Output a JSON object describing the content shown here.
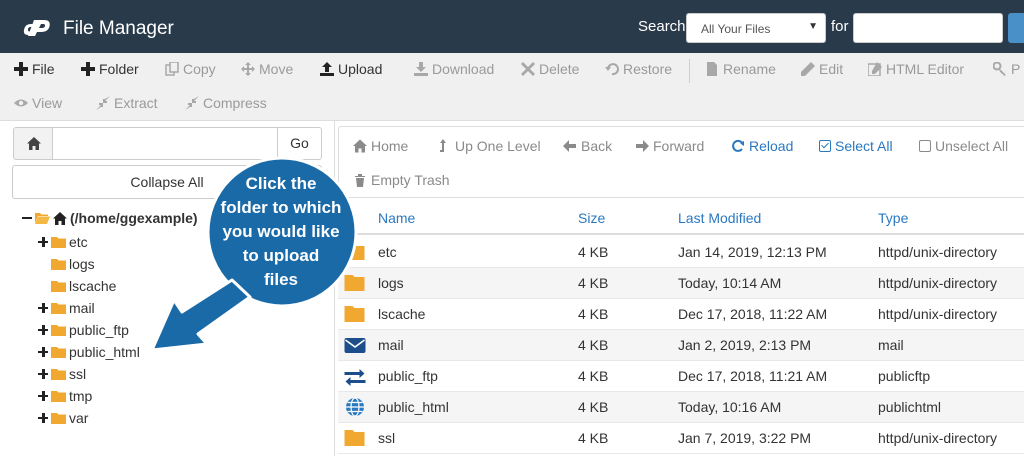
{
  "header": {
    "title": "File Manager",
    "search_label": "Search",
    "search_scope": "All Your Files",
    "for_label": "for",
    "search_value": ""
  },
  "toolbar": {
    "row1": [
      {
        "label": "File",
        "icon": "plus-icon",
        "enabled": true
      },
      {
        "label": "Folder",
        "icon": "plus-icon",
        "enabled": true
      },
      {
        "label": "Copy",
        "icon": "copy-icon",
        "enabled": false
      },
      {
        "label": "Move",
        "icon": "move-icon",
        "enabled": false
      },
      {
        "label": "Upload",
        "icon": "upload-icon",
        "enabled": true
      },
      {
        "label": "Download",
        "icon": "download-icon",
        "enabled": false
      },
      {
        "label": "Delete",
        "icon": "delete-icon",
        "enabled": false
      },
      {
        "label": "Restore",
        "icon": "restore-icon",
        "enabled": false
      },
      {
        "label": "Rename",
        "icon": "rename-icon",
        "enabled": false
      },
      {
        "label": "Edit",
        "icon": "pencil-icon",
        "enabled": false
      },
      {
        "label": "HTML Editor",
        "icon": "html-editor-icon",
        "enabled": false
      },
      {
        "label": "P",
        "icon": "key-icon",
        "enabled": false
      }
    ],
    "row2": [
      {
        "label": "View",
        "icon": "eye-icon",
        "enabled": false
      },
      {
        "label": "Extract",
        "icon": "extract-icon",
        "enabled": false
      },
      {
        "label": "Compress",
        "icon": "compress-icon",
        "enabled": false
      }
    ]
  },
  "left_panel": {
    "path_value": "",
    "go_label": "Go",
    "collapse_label": "Collapse All",
    "tree": {
      "root_label": "(/home/ggexample)",
      "children": [
        {
          "label": "etc",
          "expandable": true
        },
        {
          "label": "logs",
          "expandable": false
        },
        {
          "label": "lscache",
          "expandable": false
        },
        {
          "label": "mail",
          "expandable": true
        },
        {
          "label": "public_ftp",
          "expandable": true
        },
        {
          "label": "public_html",
          "expandable": true
        },
        {
          "label": "ssl",
          "expandable": true
        },
        {
          "label": "tmp",
          "expandable": true
        },
        {
          "label": "var",
          "expandable": true
        }
      ]
    }
  },
  "callout": {
    "lines": [
      "Click the",
      "folder to which",
      "you would like",
      "to upload",
      "files"
    ],
    "color": "#1a6aa8"
  },
  "nav": {
    "home": "Home",
    "up": "Up One Level",
    "back": "Back",
    "forward": "Forward",
    "reload": "Reload",
    "select_all": "Select All",
    "unselect_all": "Unselect All",
    "empty_trash": "Empty Trash"
  },
  "table": {
    "columns": [
      "Name",
      "Size",
      "Last Modified",
      "Type"
    ],
    "rows": [
      {
        "icon": "folder-icon",
        "name": "etc",
        "size": "4 KB",
        "modified": "Jan 14, 2019, 12:13 PM",
        "type": "httpd/unix-directory"
      },
      {
        "icon": "folder-icon",
        "name": "logs",
        "size": "4 KB",
        "modified": "Today, 10:14 AM",
        "type": "httpd/unix-directory"
      },
      {
        "icon": "folder-icon",
        "name": "lscache",
        "size": "4 KB",
        "modified": "Dec 17, 2018, 11:22 AM",
        "type": "httpd/unix-directory"
      },
      {
        "icon": "envelope-icon",
        "name": "mail",
        "size": "4 KB",
        "modified": "Jan 2, 2019, 2:13 PM",
        "type": "mail"
      },
      {
        "icon": "transfer-arrows-icon",
        "name": "public_ftp",
        "size": "4 KB",
        "modified": "Dec 17, 2018, 11:21 AM",
        "type": "publicftp"
      },
      {
        "icon": "globe-icon",
        "name": "public_html",
        "size": "4 KB",
        "modified": "Today, 10:16 AM",
        "type": "publichtml"
      },
      {
        "icon": "folder-icon",
        "name": "ssl",
        "size": "4 KB",
        "modified": "Jan 7, 2019, 3:22 PM",
        "type": "httpd/unix-directory"
      }
    ]
  },
  "colors": {
    "header_bg": "#293a4a",
    "folder": "#f0a830",
    "link_blue": "#2a78c0",
    "callout": "#1a6aa8"
  }
}
